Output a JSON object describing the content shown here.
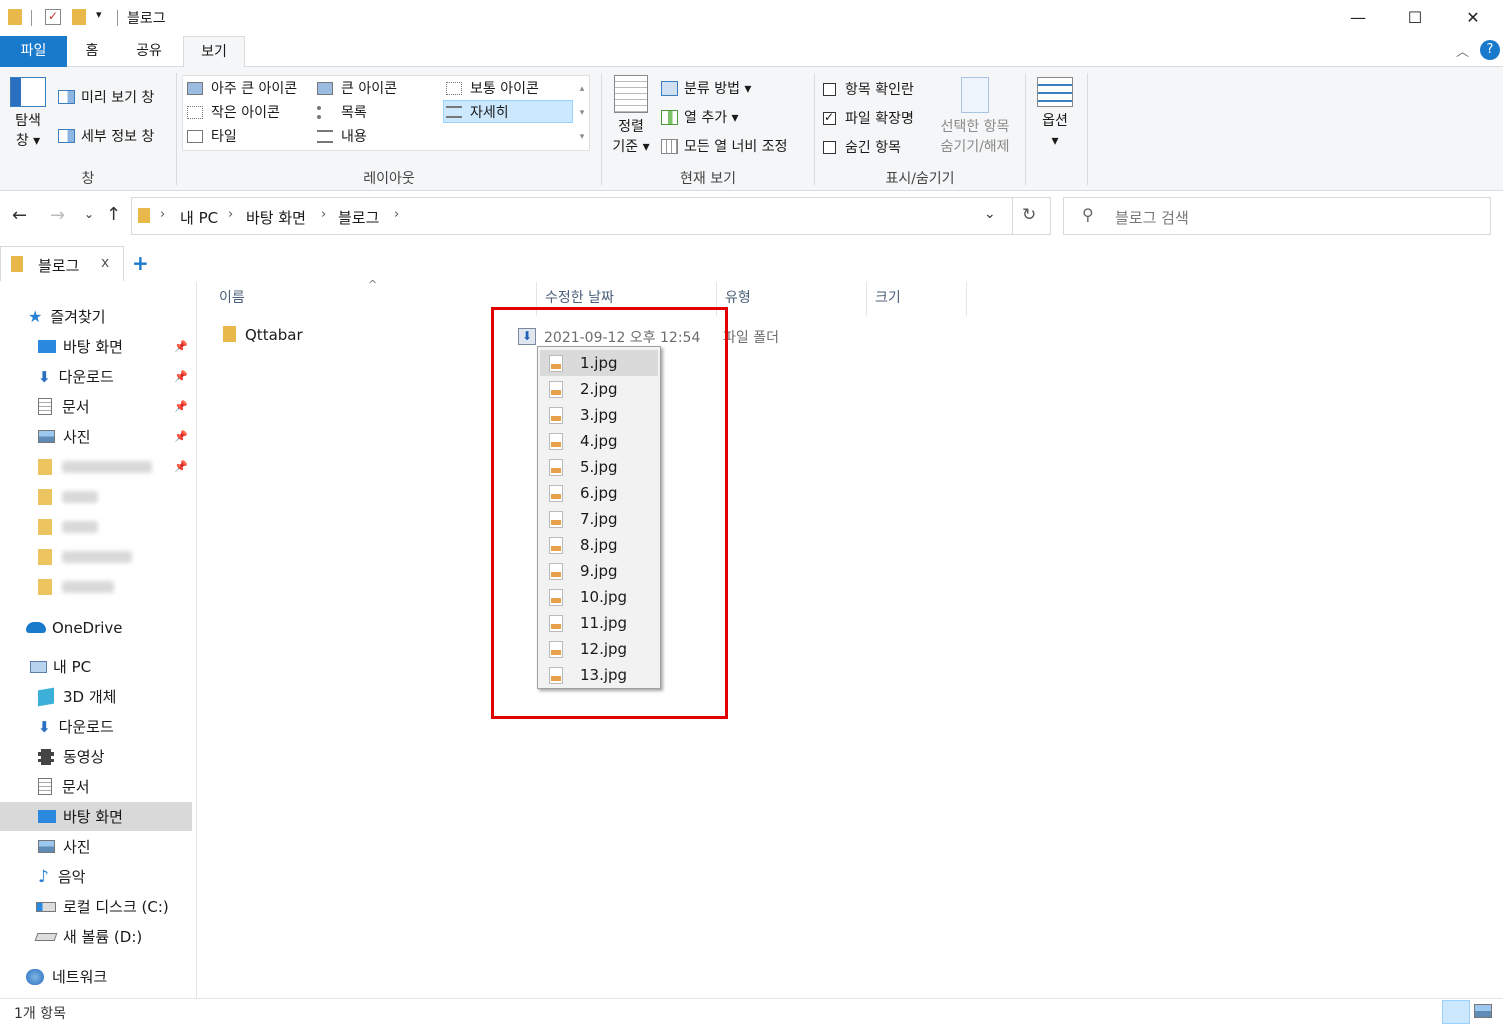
{
  "window": {
    "title": "블로그",
    "minimize": "—",
    "maximize": "☐",
    "close": "✕"
  },
  "tabs": {
    "file": "파일",
    "home": "홈",
    "share": "공유",
    "view": "보기"
  },
  "ribbon": {
    "pane": {
      "nav_pane": "탐색\n창 ▾",
      "preview": "미리 보기 창",
      "details": "세부 정보 창",
      "label": "창"
    },
    "layout": {
      "items": [
        "아주 큰 아이콘",
        "큰 아이콘",
        "보통 아이콘",
        "작은 아이콘",
        "목록",
        "자세히",
        "타일",
        "내용"
      ],
      "selected": "자세히",
      "label": "레이아웃"
    },
    "current_view": {
      "sort_by": "정렬\n기준 ▾",
      "group_by": "분류 방법 ▾",
      "add_columns": "열 추가 ▾",
      "size_all": "모든 열 너비 조정",
      "label": "현재 보기"
    },
    "show_hide": {
      "item_checkboxes": "항목 확인란",
      "file_ext": "파일 확장명",
      "hidden_items": "숨긴 항목",
      "hide_selected": "선택한 항목\n숨기기/해제",
      "label": "표시/숨기기",
      "file_ext_checked": true
    },
    "options": {
      "label": "옵션\n▾"
    }
  },
  "address": {
    "crumbs": [
      "내 PC",
      "바탕 화면",
      "블로그"
    ],
    "search_placeholder": "블로그 검색"
  },
  "qtab": {
    "label": "블로그",
    "close": "x",
    "add": "+"
  },
  "nav": {
    "quick_access": "즐겨찾기",
    "quick_items": [
      "바탕 화면",
      "다운로드",
      "문서",
      "사진"
    ],
    "onedrive": "OneDrive",
    "this_pc": "내 PC",
    "pc_items": [
      "3D 개체",
      "다운로드",
      "동영상",
      "문서",
      "바탕 화면",
      "사진",
      "음악",
      "로컬 디스크 (C:)",
      "새 볼륨 (D:)"
    ],
    "network": "네트워크"
  },
  "columns": [
    "이름",
    "수정한 날짜",
    "유형",
    "크기"
  ],
  "rows": [
    {
      "name": "Qttabar",
      "date": "2021-09-12 오후 12:54",
      "type": "파일 폴더"
    }
  ],
  "dropdown": [
    "1.jpg",
    "2.jpg",
    "3.jpg",
    "4.jpg",
    "5.jpg",
    "6.jpg",
    "7.jpg",
    "8.jpg",
    "9.jpg",
    "10.jpg",
    "11.jpg",
    "12.jpg",
    "13.jpg"
  ],
  "status": {
    "count": "1개 항목"
  },
  "colors": {
    "accent": "#1979ca",
    "highlight": "#e00000",
    "selected": "#cce8ff"
  }
}
